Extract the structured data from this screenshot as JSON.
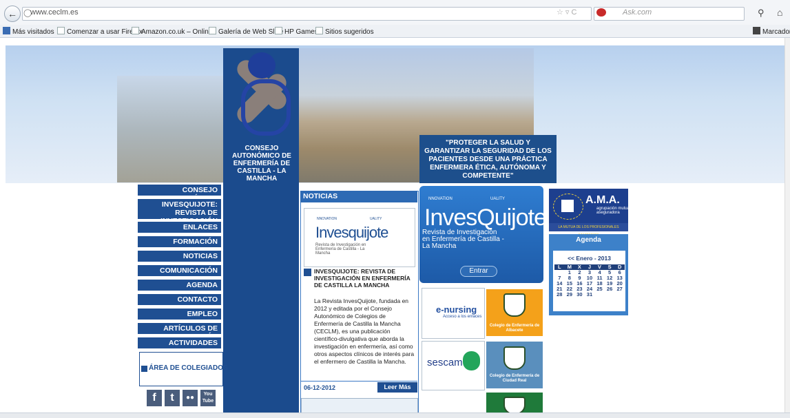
{
  "browser": {
    "url": "www.ceclm.es",
    "search_engine": "Ask.com",
    "bookmarks": [
      "Más visitados",
      "Comenzar a usar Firefox",
      "Amazon.co.uk – Onlin...",
      "Galería de Web Slice",
      "HP Games",
      "Sitios sugeridos"
    ],
    "bookmarks_right": "Marcadore"
  },
  "banner": {
    "logo_text": "CONSEJO AUTONÓMICO DE ENFERMERÍA DE CASTILLA - LA MANCHA",
    "slogan": "\"PROTEGER LA SALUD Y GARANTIZAR LA SEGURIDAD DE LOS PACIENTES DESDE UNA PRÁCTICA ENFERMERA ÉTICA, AUTÓNOMA Y COMPETENTE\""
  },
  "nav": [
    "CONSEJO AUTONÓMICO",
    "INVESQUIJOTE: REVISTA DE INVESTIGACIÓN",
    "ENLACES",
    "FORMACIÓN CONTINUADA",
    "NOTICIAS",
    "COMUNICACIÓN",
    "AGENDA",
    "CONTACTO",
    "EMPLEO",
    "ARTÍCULOS DE OPINIÓN",
    "ACTIVIDADES"
  ],
  "area": "ÁREA DE COLEGIADOS",
  "social": {
    "you": "You",
    "tube": "Tube"
  },
  "news": {
    "header": "NOTICIAS",
    "logo_top_left": "NNOVATION",
    "logo_top_right": "UALITY",
    "logo_word": "Invesquijote",
    "logo_sub": "Revista de Investigación en Enfermería de Castilla - La Mancha",
    "title": "INVESQUIJOTE: REVISTA DE INVESTIGACIÓN EN ENFERMERÍA DE CASTILLA LA MANCHA",
    "body": "La Revista InvesQuijote, fundada en 2012 y editada por el Consejo Autonómico de Colegios de Enfermería de Castilla la Mancha (CECLM), es una publicación científico-divulgativa que aborda la investigación en enfermería, así como otros aspectos clínicos de interés para el enfermero de Castilla la Mancha.",
    "date": "06-12-2012",
    "more": "Leer Más"
  },
  "invesquijote": {
    "top_left": "NNOVATION",
    "top_right": "UALITY",
    "logo": "InvesQuijote",
    "sub": "Revista de Investigación en Enfermería de Castilla - La Mancha",
    "button": "Entrar"
  },
  "links": {
    "enursing": "e-nursing",
    "enursing_sub": "Acceso a los enlaces",
    "sescam": "sescam",
    "colegio_ab": "Colegio de Enfermería de Albacete",
    "colegio_cr": "Colegio de Enfermería de Ciudad Real"
  },
  "ama": {
    "name": "A.M.A.",
    "sub1": "agrupación mutual",
    "sub2": "aseguradora",
    "foot": "LA MUTUA DE LOS PROFESIONALES SANITARIOS"
  },
  "agenda": {
    "title": "Agenda",
    "month": "<< Enero - 2013",
    "days": [
      "L",
      "M",
      "X",
      "J",
      "V",
      "S",
      "D"
    ],
    "weeks": [
      [
        "",
        "1",
        "2",
        "3",
        "4",
        "5",
        "6"
      ],
      [
        "7",
        "8",
        "9",
        "10",
        "11",
        "12",
        "13"
      ],
      [
        "14",
        "15",
        "16",
        "17",
        "18",
        "19",
        "20"
      ],
      [
        "21",
        "22",
        "23",
        "24",
        "25",
        "26",
        "27"
      ],
      [
        "28",
        "29",
        "30",
        "31",
        "",
        "",
        ""
      ]
    ]
  },
  "colors": {
    "primary": "#1f4f92",
    "accent": "#3d81c9",
    "orange": "#f4a11a"
  }
}
